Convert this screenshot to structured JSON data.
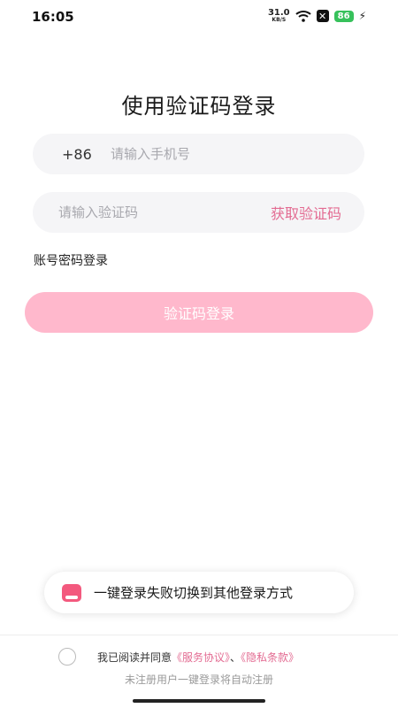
{
  "status": {
    "time": "16:05",
    "net_speed": "31.0",
    "net_unit": "KB/S",
    "battery": "86"
  },
  "title": "使用验证码登录",
  "phone": {
    "prefix": "+86",
    "placeholder": "请输入手机号"
  },
  "code": {
    "placeholder": "请输入验证码",
    "get_code": "获取验证码"
  },
  "password_login": "账号密码登录",
  "login_button": "验证码登录",
  "toast": {
    "text": "一键登录失败切换到其他登录方式"
  },
  "agreement": {
    "prefix": "我已阅读并同意",
    "service": "《服务协议》",
    "sep": "、",
    "privacy": "《隐私条款》"
  },
  "note": "未注册用户一键登录将自动注册",
  "colors": {
    "accent": "#e36b92",
    "button": "#ffb8cc",
    "field_bg": "#f5f5f7"
  }
}
